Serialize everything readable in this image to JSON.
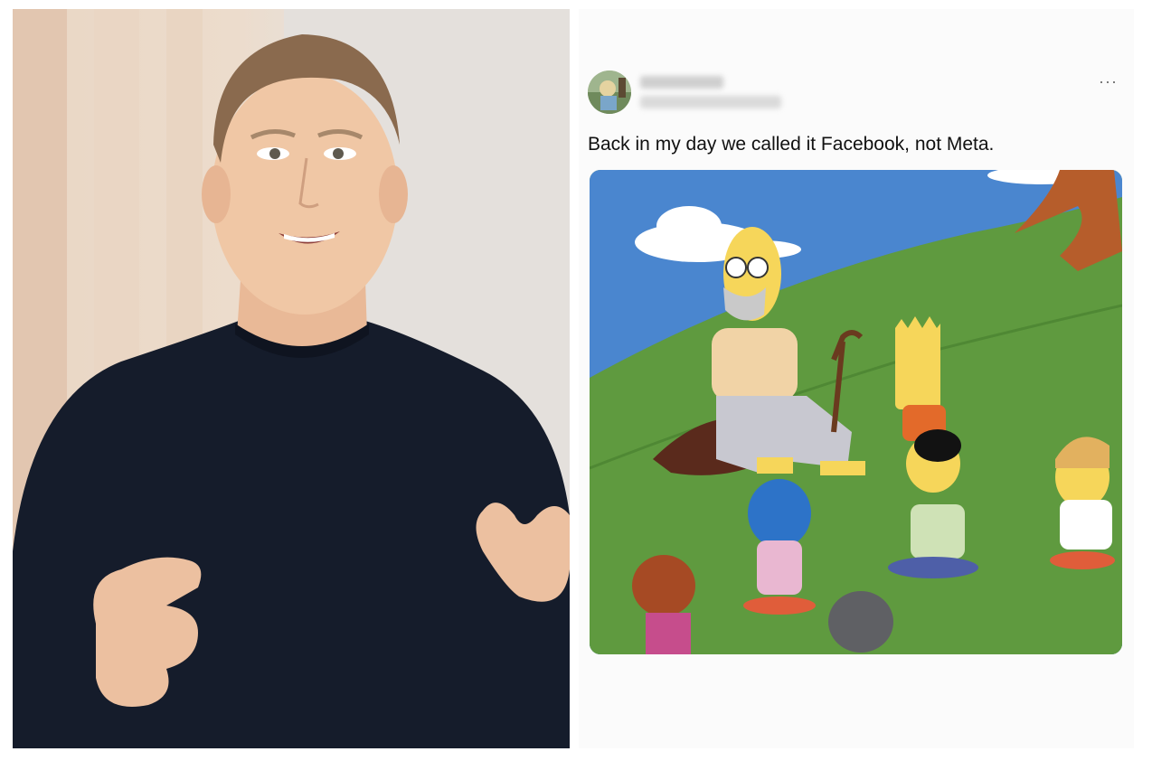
{
  "tweet": {
    "text": "Back in my day we called it Facebook, not Meta.",
    "more_glyph": "···",
    "avatar_icon": "user-avatar-icon"
  },
  "images": {
    "left": "person-speaking-photo",
    "meme": "cartoon-grandpa-storytelling-meme"
  },
  "colors": {
    "sky": "#4a86cf",
    "grass": "#5f9a3f",
    "sweater": "#151c2b",
    "skin": "#f0c7a5",
    "cartoon_yellow": "#f6d65a"
  }
}
